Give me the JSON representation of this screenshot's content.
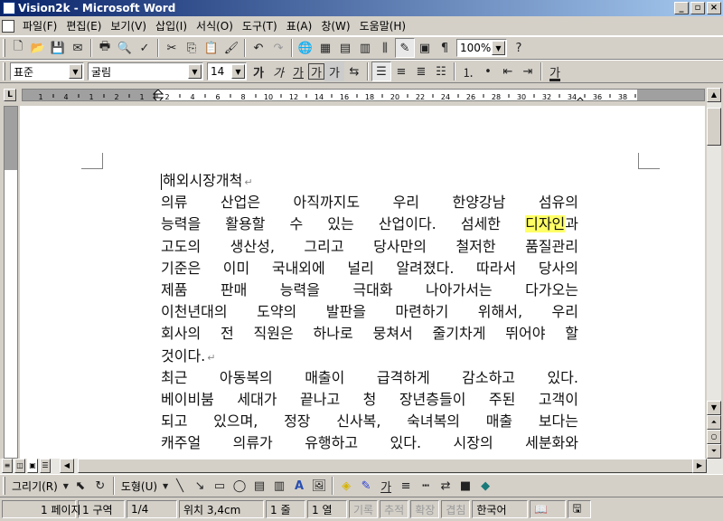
{
  "window": {
    "title": "Vision2k - Microsoft Word",
    "min_label": "_",
    "max_label": "▫",
    "close_label": "×"
  },
  "menu": [
    "파일(F)",
    "편집(E)",
    "보기(V)",
    "삽입(I)",
    "서식(O)",
    "도구(T)",
    "표(A)",
    "창(W)",
    "도움말(H)"
  ],
  "toolbar": {
    "zoom": "100%",
    "style": "표준",
    "font": "굴림",
    "size": "14",
    "bold": "가",
    "italic": "가",
    "underline": "가",
    "char_border": "가",
    "char_shade": "가",
    "font_color": "가"
  },
  "document": {
    "heading": "해외시장개척",
    "para1_lines": [
      "의류 산업은 아직까지도 우리 한양강남 섬유의",
      "능력을 활용할 수 있는 산업이다. 섬세한 ",
      "고도의 생산성, 그리고 당사만의 철저한 품질관리",
      "기준은 이미 국내외에 널리 알려졌다. 따라서 당사의",
      "제품 판매 능력을 극대화  나아가서는 다가오는",
      "이천년대의 도약의 발판을 마련하기 위해서, 우리",
      "회사의 전 직원은 하나로 뭉쳐서 줄기차게 뛰어야 할"
    ],
    "highlight_word": "디자인",
    "after_highlight": "과",
    "para1_last": "것이다.",
    "para2_lines": [
      "최근 아동복의 매출이 급격하게 감소하고 있다.",
      "베이비붐 세대가 끝나고 청 장년층들이 주된 고객이",
      "되고 있으며,  정장 신사복, 숙녀복의 매출 보다는",
      "캐주얼 의류가 유행하고 있다. 시장의 세분화와"
    ],
    "para_mark": "↵"
  },
  "drawbar": {
    "draw": "그리기(R)",
    "autoshapes": "도형(U)",
    "font_color": "가"
  },
  "status": {
    "page": "1 페이지",
    "section": "1 구역",
    "pages": "1/4",
    "position": "위치 3,4cm",
    "line": "1 줄",
    "column": "1 열",
    "rec": "기록",
    "trk": "추적",
    "ext": "확장",
    "ovr": "겹침",
    "language": "한국어"
  },
  "ruler_numbers": [
    "1",
    "4",
    "1",
    "2",
    "1",
    "2",
    "4",
    "6",
    "8",
    "10",
    "12",
    "14",
    "16",
    "18",
    "20",
    "22",
    "24",
    "26",
    "28",
    "30",
    "32",
    "34",
    "36",
    "38"
  ]
}
